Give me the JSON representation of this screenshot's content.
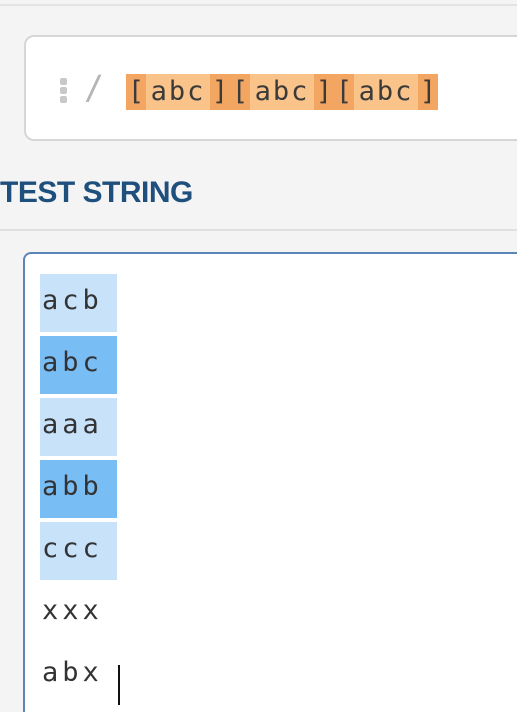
{
  "regex": {
    "delimiter": "/",
    "flag_handle_icon": "drag-handle-icon",
    "tokens": [
      {
        "open": "[",
        "content": "abc",
        "close": "]"
      },
      {
        "open": "[",
        "content": "abc",
        "close": "]"
      },
      {
        "open": "[",
        "content": "abc",
        "close": "]"
      }
    ]
  },
  "test_string": {
    "title": "TEST STRING",
    "lines": [
      {
        "text": "acb",
        "match": "light"
      },
      {
        "text": "abc",
        "match": "dark"
      },
      {
        "text": "aaa",
        "match": "light"
      },
      {
        "text": "abb",
        "match": "dark"
      },
      {
        "text": "ccc",
        "match": "light"
      },
      {
        "text": "xxx",
        "match": "none"
      },
      {
        "text": "abx",
        "match": "none"
      }
    ]
  },
  "colors": {
    "token_bracket": "#f2a662",
    "token_content": "#fac38a",
    "match_light": "#c8e2fa",
    "match_dark": "#79bdf5",
    "title": "#1e4f7d",
    "editor_border_focus": "#5a86b6"
  }
}
